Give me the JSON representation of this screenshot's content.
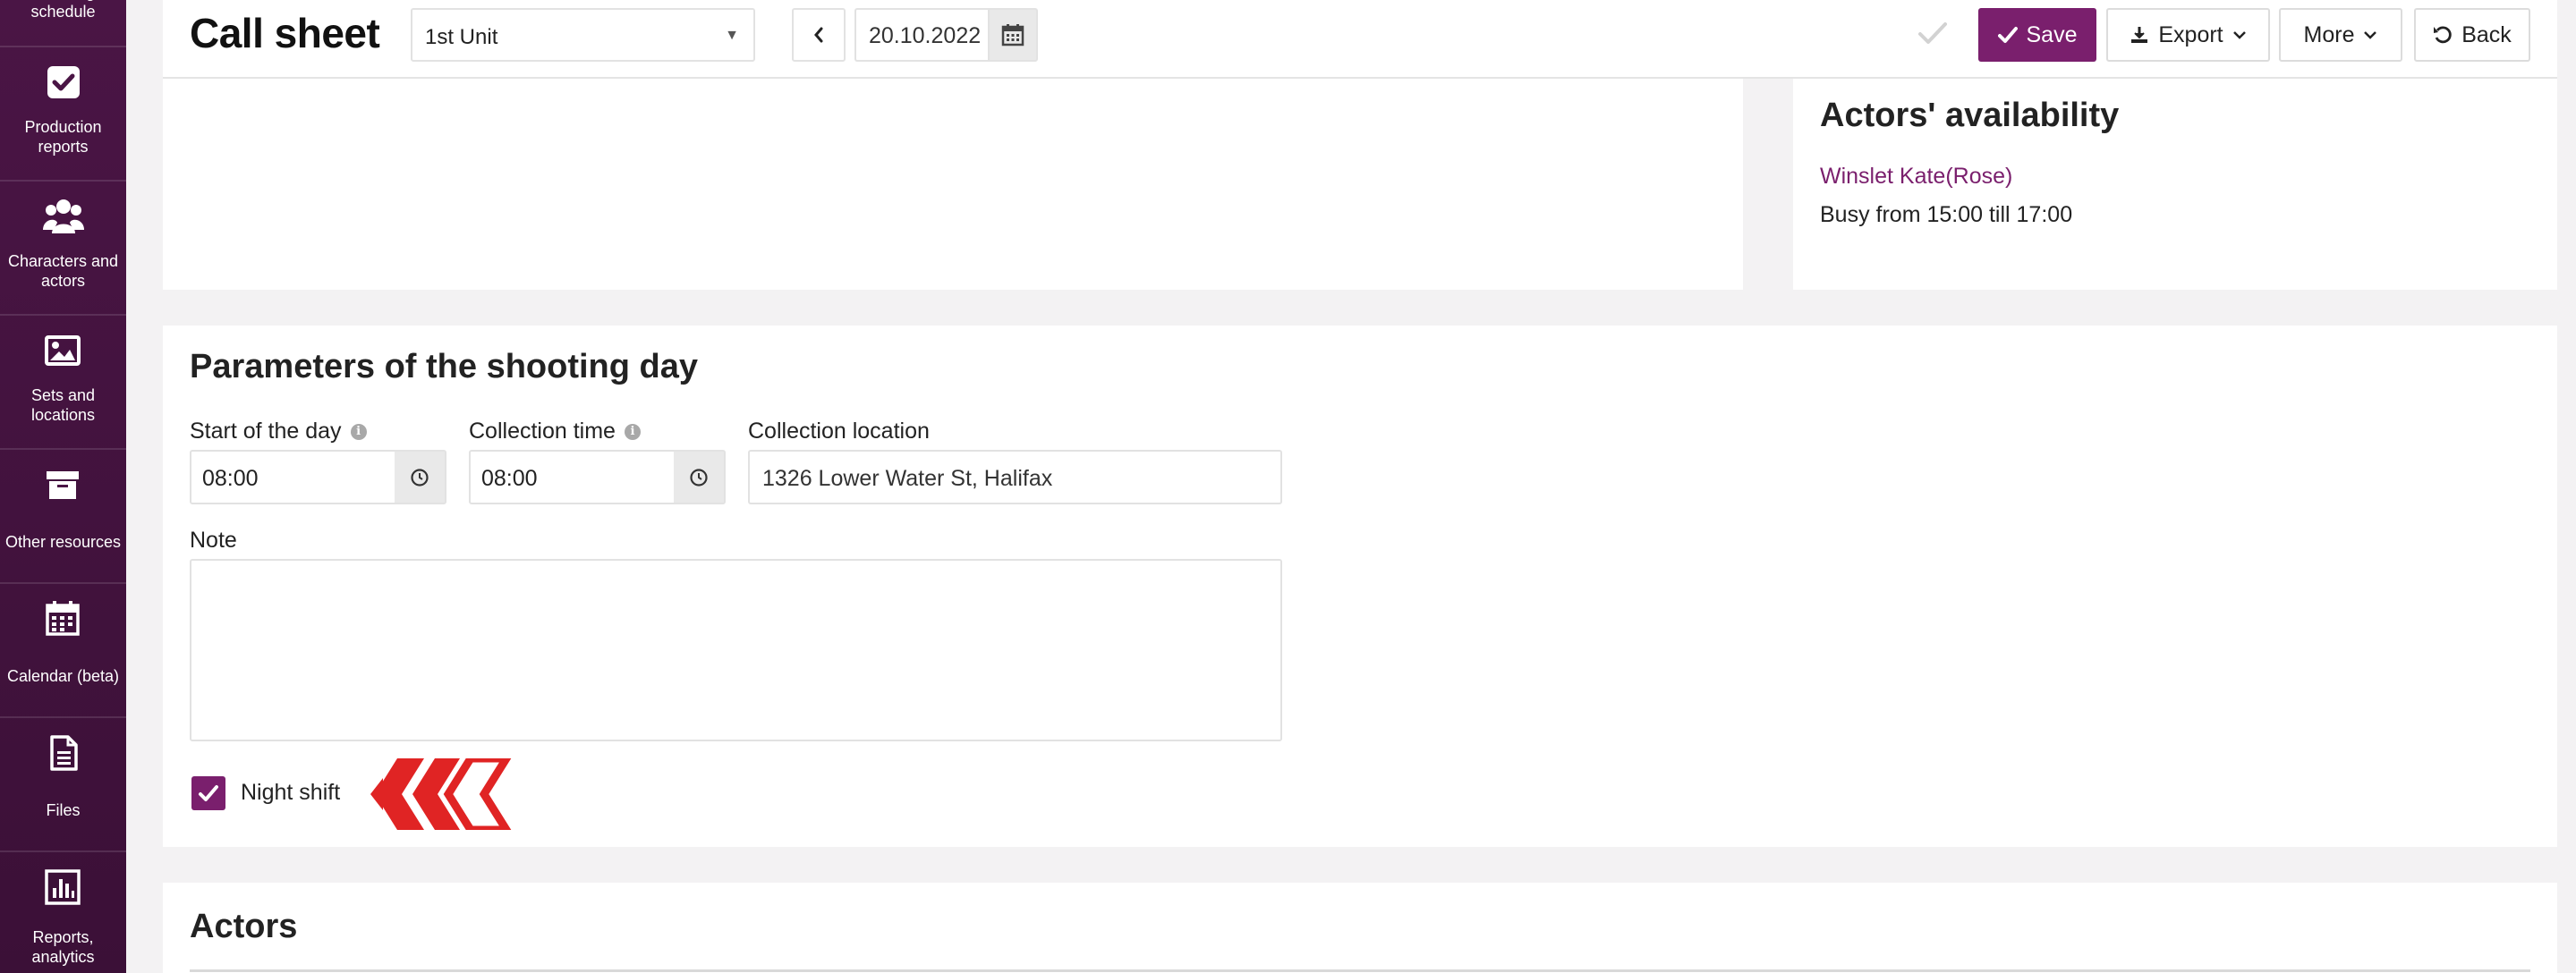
{
  "sidebar": {
    "items": [
      {
        "label": "Shooting schedule",
        "icon": "schedule-icon"
      },
      {
        "label": "Production reports",
        "icon": "checkbox-icon"
      },
      {
        "label": "Characters and actors",
        "icon": "users-icon"
      },
      {
        "label": "Sets and locations",
        "icon": "image-icon"
      },
      {
        "label": "Other resources",
        "icon": "archive-box-icon"
      },
      {
        "label": "Calendar (beta)",
        "icon": "calendar-icon"
      },
      {
        "label": "Files",
        "icon": "file-icon"
      },
      {
        "label": "Reports, analytics",
        "icon": "bar-chart-icon"
      }
    ]
  },
  "header": {
    "title": "Call sheet",
    "unit_select": "1st Unit",
    "date": "20.10.2022",
    "save": "Save",
    "export": "Export",
    "more": "More",
    "back": "Back"
  },
  "availability": {
    "title": "Actors' availability",
    "actor": "Winslet Kate(Rose)",
    "busy": "Busy from 15:00 till 17:00"
  },
  "params": {
    "title": "Parameters of the shooting day",
    "start_label": "Start of the day",
    "start_value": "08:00",
    "collection_time_label": "Collection time",
    "collection_time_value": "08:00",
    "collection_location_label": "Collection location",
    "collection_location_value": "1326 Lower Water St, Halifax",
    "note_label": "Note",
    "note_value": "",
    "night_shift_label": "Night shift",
    "night_shift_checked": true
  },
  "actors": {
    "title": "Actors"
  },
  "colors": {
    "sidebar_bg": "#4a1545",
    "accent": "#7a1f6d",
    "arrow": "#e02424"
  }
}
